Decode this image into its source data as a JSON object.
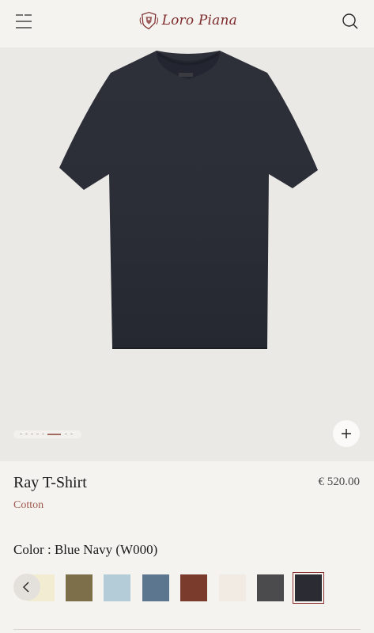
{
  "header": {
    "menu_icon": "hamburger-menu-icon",
    "logo_text": "Loro Piana",
    "search_icon": "search-icon"
  },
  "gallery": {
    "image_subject": "navy t-shirt",
    "pager_total": 7,
    "pager_active_index": 4,
    "zoom_icon": "plus-icon"
  },
  "product": {
    "name": "Ray T-Shirt",
    "material": "Cotton",
    "price": "€ 520.00"
  },
  "color": {
    "label": "Color : Blue Navy (W000)",
    "prev_icon": "chevron-left-icon",
    "swatches": [
      {
        "color": "#f1ecd2"
      },
      {
        "color": "#7c6f4a"
      },
      {
        "color": "#b3ccd8"
      },
      {
        "color": "#5d7690"
      },
      {
        "color": "#7a3a2c"
      },
      {
        "color": "#f1ebe4"
      },
      {
        "color": "#4b4b4d"
      },
      {
        "color": "#2a2b33",
        "selected": true
      }
    ]
  },
  "colors": {
    "accent": "#7d2a2a",
    "material_text": "#a0574d",
    "background": "#f5f3ef",
    "gallery_background": "#ebe9e6"
  }
}
